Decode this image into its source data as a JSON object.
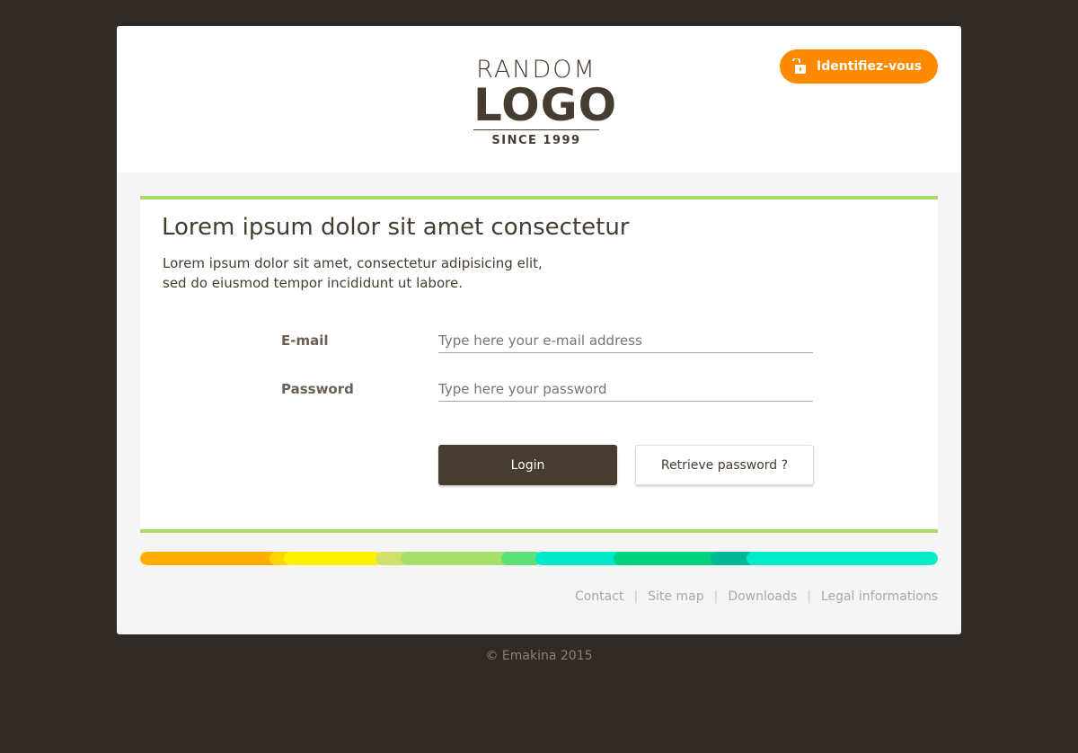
{
  "header": {
    "logo": {
      "top_text": "RANDOM",
      "main_text": "LOGO",
      "sub_text": "SINCE 1999"
    },
    "login_button": {
      "label": "Identifiez-vous",
      "icon": "unlock-icon",
      "color": "#ff8a00"
    }
  },
  "main": {
    "title": "Lorem ipsum dolor sit amet consectetur",
    "description_line1": "Lorem ipsum dolor sit amet, consectetur adipisicing elit,",
    "description_line2": "sed do eiusmod tempor incididunt ut labore.",
    "form": {
      "email_label": "E-mail",
      "email_placeholder": "Type here your e-mail address",
      "email_value": "",
      "password_label": "Password",
      "password_placeholder": "Type here your password",
      "password_value": "",
      "login_label": "Login",
      "retrieve_label": "Retrieve password ?"
    },
    "accent_color": "#a6dd6a"
  },
  "color_bar": [
    "#ffad00",
    "#ffd500",
    "#fff200",
    "#d0e06a",
    "#a6e06a",
    "#5ce07a",
    "#00e8c8",
    "#00d080",
    "#00b894",
    "#00ecc8"
  ],
  "footer": {
    "links": [
      "Contact",
      "Site map",
      "Downloads",
      "Legal informations"
    ],
    "copyright": "© Emakina 2015"
  },
  "colors": {
    "background": "#302b26",
    "primary_button": "#463c2f"
  }
}
